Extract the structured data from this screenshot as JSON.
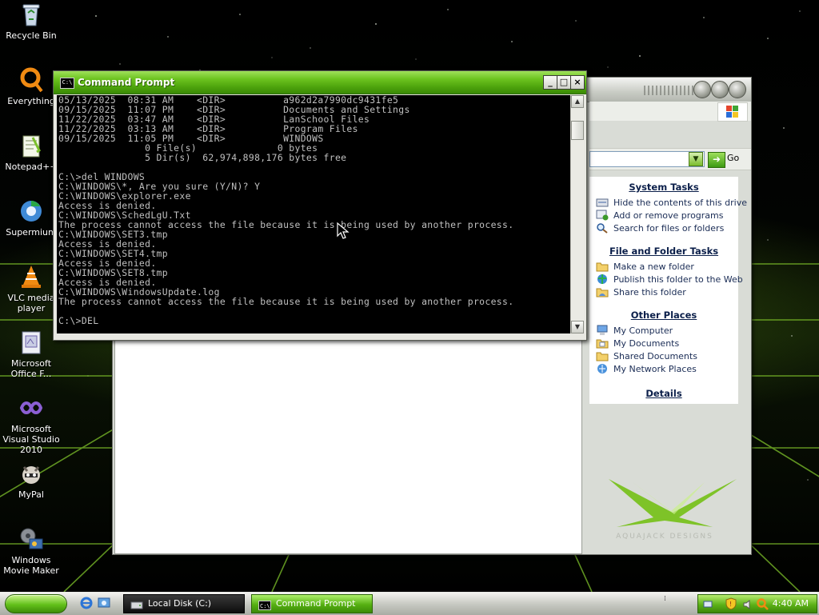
{
  "desktop": {
    "icons": [
      {
        "label": "Recycle Bin",
        "icon": "recycle-bin-icon"
      },
      {
        "label": "Everything",
        "icon": "everything-search-icon"
      },
      {
        "label": "Notepad++",
        "icon": "notepad-plus-plus-icon"
      },
      {
        "label": "Supermium",
        "icon": "supermium-browser-icon"
      },
      {
        "label": "VLC media player",
        "icon": "vlc-cone-icon"
      },
      {
        "label": "Microsoft Office F...",
        "icon": "office-document-icon"
      },
      {
        "label": "Microsoft Visual Studio 2010",
        "icon": "visual-studio-infinity-icon"
      },
      {
        "label": "MyPal",
        "icon": "mypal-raccoon-icon"
      },
      {
        "label": "Windows Movie Maker",
        "icon": "movie-maker-film-icon"
      }
    ]
  },
  "cmd": {
    "title": "Command Prompt",
    "icon_text": "C:\\",
    "minimize": "_",
    "maximize": "□",
    "close": "×",
    "lines": [
      "05/13/2025  08:31 AM    <DIR>          a962d2a7990dc9431fe5",
      "09/15/2025  11:07 PM    <DIR>          Documents and Settings",
      "11/22/2025  03:47 AM    <DIR>          LanSchool Files",
      "11/22/2025  03:13 AM    <DIR>          Program Files",
      "09/15/2025  11:05 PM    <DIR>          WINDOWS",
      "               0 File(s)              0 bytes",
      "               5 Dir(s)  62,974,898,176 bytes free",
      "",
      "C:\\>del WINDOWS",
      "C:\\WINDOWS\\*, Are you sure (Y/N)? Y",
      "C:\\WINDOWS\\explorer.exe",
      "Access is denied.",
      "C:\\WINDOWS\\SchedLgU.Txt",
      "The process cannot access the file because it is being used by another process.",
      "C:\\WINDOWS\\SET3.tmp",
      "Access is denied.",
      "C:\\WINDOWS\\SET4.tmp",
      "Access is denied.",
      "C:\\WINDOWS\\SET8.tmp",
      "Access is denied.",
      "C:\\WINDOWS\\WindowsUpdate.log",
      "The process cannot access the file because it is being used by another process.",
      "",
      "C:\\>DEL"
    ],
    "scroll_up": "▲",
    "scroll_down": "▼"
  },
  "explorer": {
    "address_dropdown": "▼",
    "go_arrow": "➜",
    "go_label": "Go",
    "system_tasks": {
      "title": "System Tasks",
      "items": [
        {
          "label": "Hide the contents of this drive",
          "icon": "hide-drive-icon"
        },
        {
          "label": "Add or remove programs",
          "icon": "add-remove-programs-icon"
        },
        {
          "label": "Search for files or folders",
          "icon": "search-icon"
        }
      ]
    },
    "file_tasks": {
      "title": "File and Folder Tasks",
      "items": [
        {
          "label": "Make a new folder",
          "icon": "new-folder-icon"
        },
        {
          "label": "Publish this folder to the Web",
          "icon": "publish-web-icon"
        },
        {
          "label": "Share this folder",
          "icon": "share-folder-icon"
        }
      ]
    },
    "other_places": {
      "title": "Other Places",
      "items": [
        {
          "label": "My Computer",
          "icon": "my-computer-icon"
        },
        {
          "label": "My Documents",
          "icon": "my-documents-icon"
        },
        {
          "label": "Shared Documents",
          "icon": "shared-documents-icon"
        },
        {
          "label": "My Network Places",
          "icon": "network-places-icon"
        }
      ]
    },
    "details": {
      "title": "Details"
    },
    "watermark": "AQUAJACK DESIGNS"
  },
  "taskbar": {
    "buttons": [
      {
        "label": "Local Disk (C:)",
        "icon": "drive-icon",
        "active": false
      },
      {
        "label": "Command Prompt",
        "icon": "cmd-icon",
        "active": true
      }
    ],
    "clock": "4:40 AM"
  },
  "colors": {
    "accent_green": "#4ea40d",
    "console_bg": "#000000",
    "console_text": "#c0c0c0",
    "task_link": "#1a2c55"
  }
}
